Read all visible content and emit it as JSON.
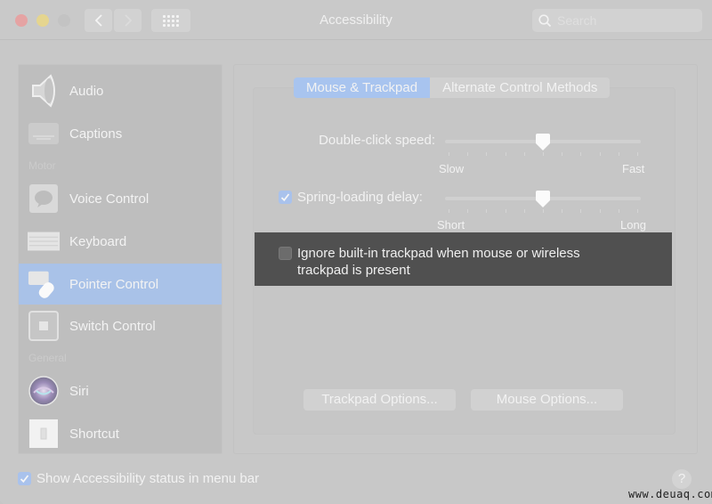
{
  "window": {
    "title": "Accessibility",
    "search": {
      "placeholder": "Search",
      "value": ""
    }
  },
  "sidebar": {
    "items": [
      {
        "label": "Audio",
        "icon": "speaker-icon",
        "selected": false
      },
      {
        "label": "Captions",
        "icon": "captions-icon",
        "selected": false
      },
      {
        "section": "Motor"
      },
      {
        "label": "Voice Control",
        "icon": "voice-control-icon",
        "selected": false
      },
      {
        "label": "Keyboard",
        "icon": "keyboard-icon",
        "selected": false
      },
      {
        "label": "Pointer Control",
        "icon": "pointer-control-icon",
        "selected": true
      },
      {
        "label": "Switch Control",
        "icon": "switch-control-icon",
        "selected": false
      },
      {
        "section": "General"
      },
      {
        "label": "Siri",
        "icon": "siri-icon",
        "selected": false
      },
      {
        "label": "Shortcut",
        "icon": "shortcut-icon",
        "selected": false
      }
    ]
  },
  "tabs": [
    {
      "label": "Mouse & Trackpad",
      "active": true
    },
    {
      "label": "Alternate Control Methods",
      "active": false
    }
  ],
  "settings": {
    "double_click": {
      "label": "Double-click speed:",
      "min_label": "Slow",
      "max_label": "Fast",
      "ticks": 11,
      "value_fraction": 0.5
    },
    "spring_loading": {
      "label": "Spring-loading delay:",
      "checked": true,
      "min_label": "Short",
      "max_label": "Long",
      "ticks": 11,
      "value_fraction": 0.5
    },
    "ignore_trackpad": {
      "label_line1": "Ignore built-in trackpad when mouse or wireless",
      "label_line2": "trackpad is present",
      "checked": false
    }
  },
  "buttons": {
    "trackpad_options": "Trackpad Options...",
    "mouse_options": "Mouse Options..."
  },
  "footer": {
    "show_status_label": "Show Accessibility status in menu bar",
    "show_status_checked": true,
    "help": "?"
  },
  "watermark": "www.deuaq.com",
  "colors": {
    "accent": "#a9c2ec",
    "highlight_overlay": "#505050",
    "background": "#c8c8c8"
  }
}
